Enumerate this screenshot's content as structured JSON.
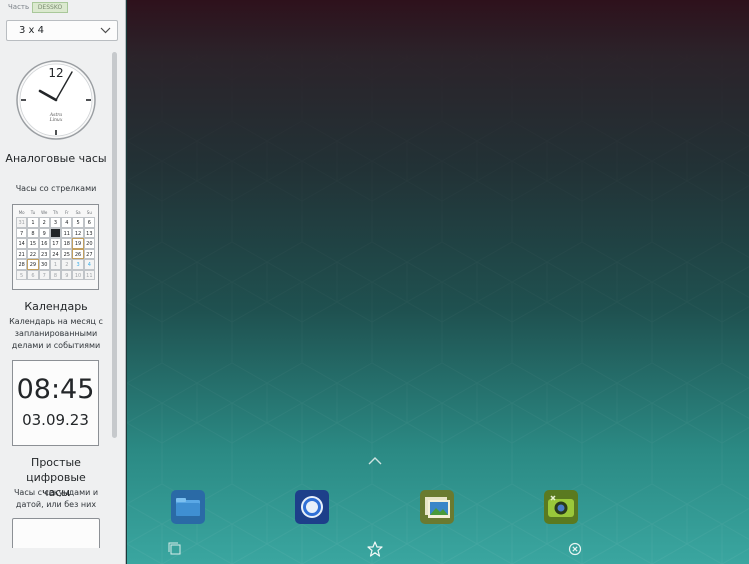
{
  "panel": {
    "hint_label": "Часть",
    "hint_badge": "DESSKO",
    "grid_select": {
      "value": "3 x 4",
      "icon": "chevron-down-icon"
    },
    "widgets": [
      {
        "title": "Аналоговые часы",
        "description": "Часы со стрелками",
        "preview": {
          "numeral": "12",
          "brand_line1": "Astra",
          "brand_line2": "Linux"
        }
      },
      {
        "title": "Календарь",
        "description": "Календарь на месяц с запланированными делами и событиями",
        "preview": {
          "weekdays": [
            "Mo",
            "Tu",
            "We",
            "Th",
            "Fr",
            "Sa",
            "Su"
          ],
          "days": [
            "31",
            "1",
            "2",
            "3",
            "4",
            "5",
            "6",
            "7",
            "8",
            "9",
            "10",
            "11",
            "12",
            "13",
            "14",
            "15",
            "16",
            "17",
            "18",
            "19",
            "20",
            "21",
            "22",
            "23",
            "24",
            "25",
            "26",
            "27",
            "28",
            "29",
            "30",
            "1",
            "2",
            "3",
            "4",
            "5",
            "6",
            "7",
            "8",
            "9",
            "10",
            "11"
          ]
        }
      },
      {
        "title": "Простые цифровые часы",
        "description": "Часы с секундами и датой, или без них",
        "preview": {
          "time": "08:45",
          "date": "03.09.23"
        }
      }
    ]
  },
  "desktop": {
    "colors": {
      "top": "#2e111c",
      "bottom": "#3aa6a0"
    },
    "dock": [
      {
        "name": "file-manager-icon",
        "color": "#2a6aa6"
      },
      {
        "name": "browser-icon",
        "color": "#1d3f8a"
      },
      {
        "name": "image-viewer-icon",
        "color": "#6a7a30"
      },
      {
        "name": "camera-icon",
        "color": "#5a7a20"
      }
    ],
    "controls": [
      "expand-up-icon",
      "multitask-icon",
      "favorites-star-icon",
      "close-circle-icon"
    ]
  }
}
